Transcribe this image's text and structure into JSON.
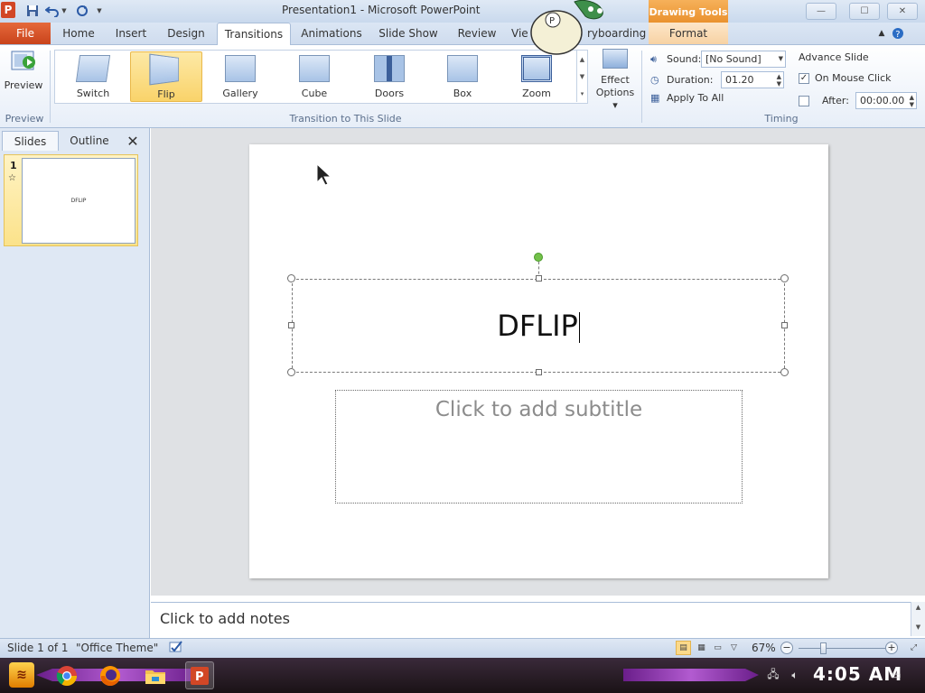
{
  "window": {
    "title": "Presentation1 - Microsoft PowerPoint",
    "context_tab_header": "Drawing Tools",
    "minimize": "—",
    "maximize": "☐",
    "close": "✕"
  },
  "tabs": {
    "file": "File",
    "items": [
      "Home",
      "Insert",
      "Design",
      "Transitions",
      "Animations",
      "Slide Show",
      "Review",
      "View",
      "Storyboarding"
    ],
    "view_partial": "Vie",
    "storyboarding_partial": "ryboarding",
    "format": "Format",
    "active": "Transitions"
  },
  "ribbon": {
    "preview": {
      "label": "Preview",
      "group": "Preview"
    },
    "transitions": {
      "items": [
        "Switch",
        "Flip",
        "Gallery",
        "Cube",
        "Doors",
        "Box",
        "Zoom"
      ],
      "selected": "Flip",
      "group": "Transition to This Slide"
    },
    "effect_options": {
      "line1": "Effect",
      "line2": "Options"
    },
    "timing": {
      "sound_label": "Sound:",
      "sound_value": "[No Sound]",
      "duration_label": "Duration:",
      "duration_value": "01.20",
      "apply_all": "Apply To All",
      "advance_label": "Advance Slide",
      "on_mouse_click": "On Mouse Click",
      "on_mouse_click_checked": true,
      "after_label": "After:",
      "after_value": "00:00.00",
      "after_checked": false,
      "group": "Timing"
    }
  },
  "left_pane": {
    "tabs": [
      "Slides",
      "Outline"
    ],
    "active_tab": "Slides",
    "slide_number": "1",
    "slide_star": "☆",
    "thumb_text": "DFLIP"
  },
  "slide": {
    "title": "DFLIP",
    "subtitle_placeholder": "Click to add subtitle"
  },
  "notes": {
    "placeholder": "Click to add notes"
  },
  "status_bar": {
    "slide_info": "Slide 1 of 1",
    "theme": "\"Office Theme\"",
    "zoom": "67%"
  },
  "taskbar": {
    "clock": "4:05 AM",
    "apps": [
      "start",
      "chrome",
      "firefox",
      "file-explorer",
      "powerpoint"
    ]
  },
  "colors": {
    "file_tab": "#d24726",
    "context_tab": "#e9902c",
    "selected_transition": "#f9d36a"
  }
}
